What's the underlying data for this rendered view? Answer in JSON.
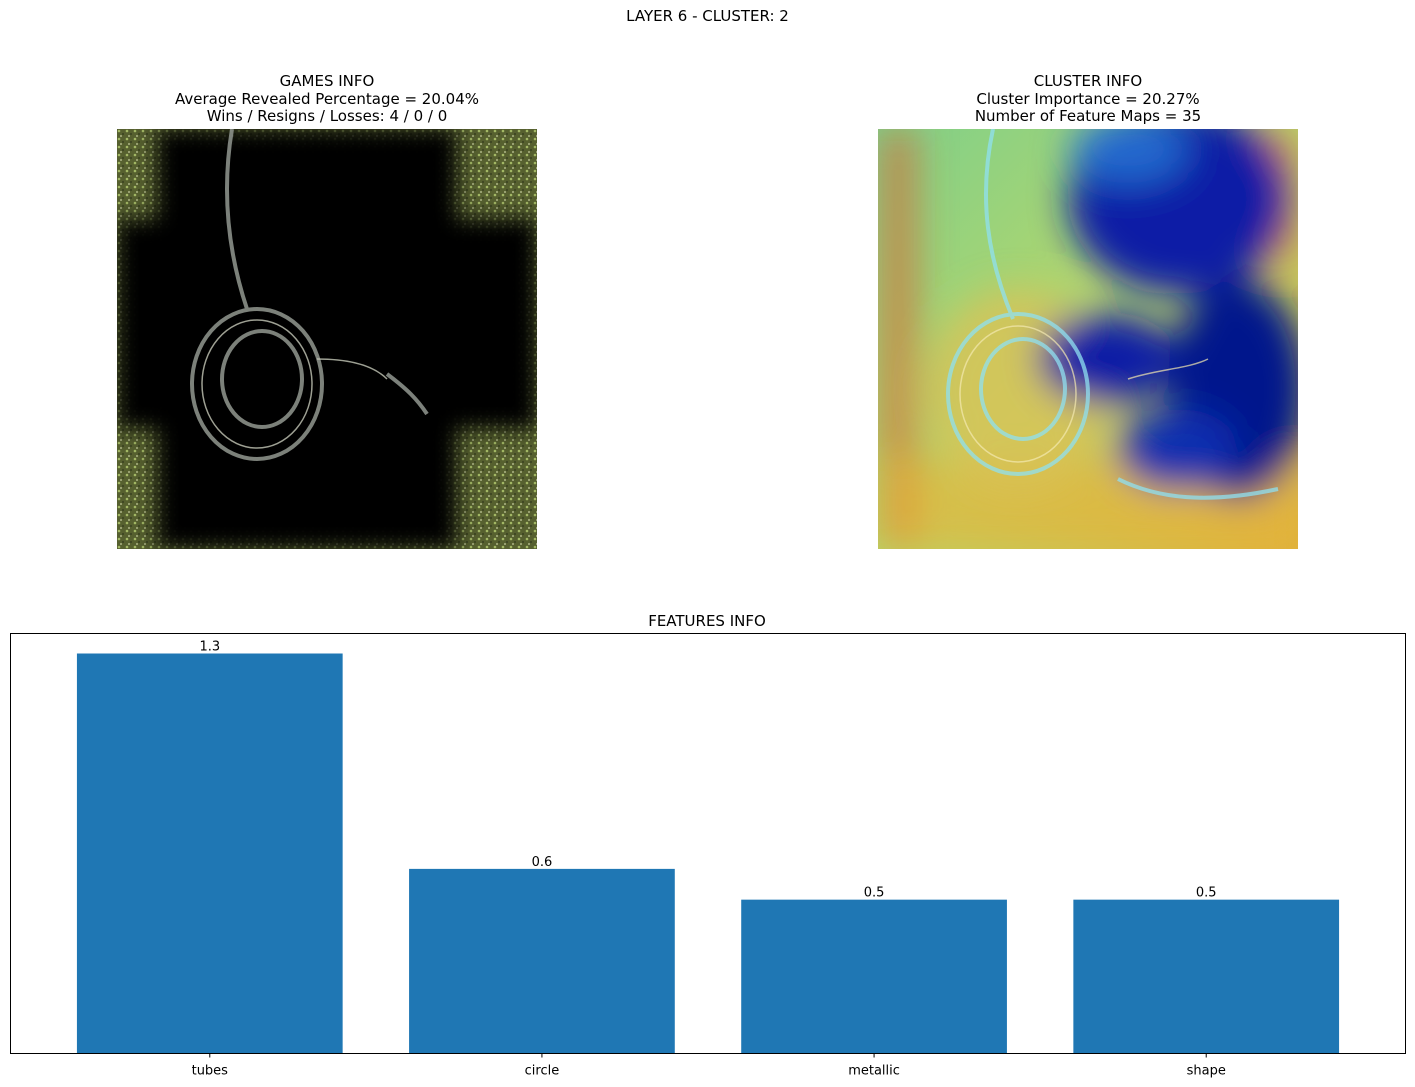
{
  "figure": {
    "suptitle": "LAYER 6 - CLUSTER: 2"
  },
  "games_info": {
    "title": "GAMES INFO",
    "line1": "Average Revealed Percentage = 20.04%",
    "line2": "Wins / Resigns / Losses: 4 / 0 / 0",
    "image_icon": "masked-french-horn-image"
  },
  "cluster_info": {
    "title": "CLUSTER INFO",
    "line1": "Cluster Importance = 20.27%",
    "line2": "Number of Feature Maps = 35",
    "image_icon": "heatmap-french-horn-image"
  },
  "chart_data": {
    "type": "bar",
    "title": "FEATURES INFO",
    "categories": [
      "tubes",
      "circle",
      "metallic",
      "shape"
    ],
    "values": [
      1.3,
      0.6,
      0.5,
      0.5
    ],
    "value_labels": [
      "1.3",
      "0.6",
      "0.5",
      "0.5"
    ],
    "xlabel": "",
    "ylabel": "",
    "ylim": [
      0,
      1.3
    ],
    "yticks_visible": false,
    "grid": false,
    "bar_color": "#1f77b4"
  }
}
